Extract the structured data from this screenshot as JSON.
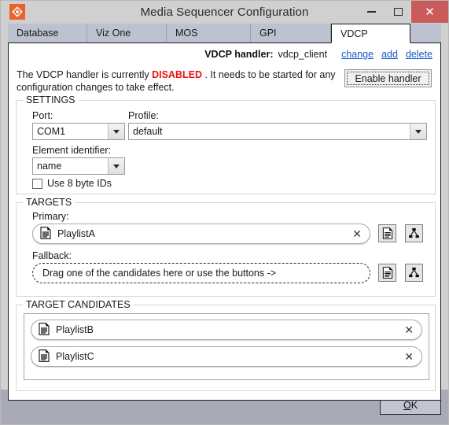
{
  "window": {
    "title": "Media Sequencer Configuration",
    "app_icon": "viz-diamond-icon",
    "minimize_label": "Minimize",
    "maximize_label": "Maximize",
    "close_label": "Close",
    "close_glyph": "✕",
    "accent_orange": "#e8642a",
    "close_red": "#ca5b5b",
    "titlebar_bg": "#d0d0d0"
  },
  "tabs": [
    {
      "label": "Database",
      "active": false
    },
    {
      "label": "Viz One",
      "active": false
    },
    {
      "label": "MOS",
      "active": false
    },
    {
      "label": "GPI",
      "active": false
    },
    {
      "label": "VDCP",
      "active": true
    }
  ],
  "handler": {
    "label": "VDCP handler:",
    "name": "vdcp_client",
    "links": [
      {
        "label": "change"
      },
      {
        "label": "add"
      },
      {
        "label": "delete"
      }
    ],
    "link_color": "#1659c7"
  },
  "status": {
    "prefix": "The VDCP handler is currently",
    "state": "DISABLED",
    "state_color": "#ee1111",
    "suffix": ". It needs to be started for any configuration  changes to take effect.",
    "enable_button": "Enable handler"
  },
  "settings": {
    "legend": "SETTINGS",
    "port": {
      "label": "Port:",
      "value": "COM1"
    },
    "profile": {
      "label": "Profile:",
      "value": "default"
    },
    "element_identifier": {
      "label": "Element identifier:",
      "value": "name"
    },
    "use_8_byte_ids": {
      "label": "Use 8 byte IDs",
      "checked": false
    }
  },
  "targets": {
    "legend": "TARGETS",
    "primary": {
      "label": "Primary:",
      "item": {
        "icon": "document-icon",
        "name": "PlaylistA",
        "remove_glyph": "✕"
      },
      "buttons": [
        {
          "icon": "document-icon",
          "name": "add-playlist-button"
        },
        {
          "icon": "hierarchy-icon",
          "name": "add-tree-button"
        }
      ]
    },
    "fallback": {
      "label": "Fallback:",
      "placeholder": "Drag one of the candidates here or use the buttons ->",
      "buttons": [
        {
          "icon": "document-icon",
          "name": "add-playlist-button"
        },
        {
          "icon": "hierarchy-icon",
          "name": "add-tree-button"
        }
      ]
    }
  },
  "candidates": {
    "legend": "TARGET CANDIDATES",
    "items": [
      {
        "icon": "document-icon",
        "name": "PlaylistB",
        "remove_glyph": "✕"
      },
      {
        "icon": "document-icon",
        "name": "PlaylistC",
        "remove_glyph": "✕"
      }
    ]
  },
  "footer": {
    "ok_accel": "O",
    "ok_rest": "K"
  }
}
